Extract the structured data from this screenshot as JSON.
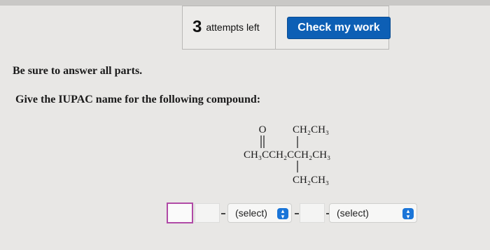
{
  "toolbar": {
    "attempts_number": "3",
    "attempts_text": "attempts left",
    "check_button_label": "Check my work"
  },
  "instructions": {
    "line1": "Be sure to answer all parts.",
    "line2": "Give the IUPAC name for the following compound:"
  },
  "structure": {
    "oxygen": "O",
    "top_substituent": "CH₂CH₃",
    "main_chain": "CH₃CCH₂CCH₂CH₃",
    "bottom_substituent": "CH₂CH₃"
  },
  "answer": {
    "select1": "(select)",
    "select2": "(select)"
  },
  "colors": {
    "button_blue": "#0d5fb5",
    "focus_border": "#b04aa6",
    "select_chevron": "#1a75d8"
  }
}
